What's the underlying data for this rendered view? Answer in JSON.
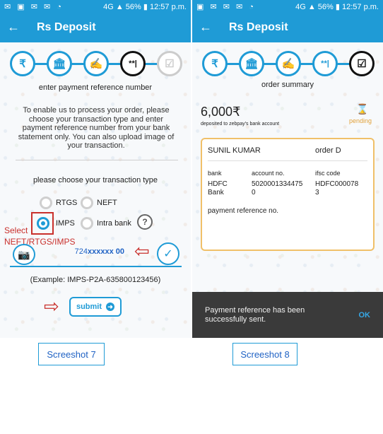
{
  "status_bar": {
    "battery": "56%",
    "time": "12:57 p.m.",
    "signal": "4G"
  },
  "appbar": {
    "title": "Rs Deposit",
    "back_icon": "arrow-left-icon"
  },
  "colors": {
    "primary": "#1f9bd6",
    "annotation_red": "#c9302c",
    "pending": "#e2a23b",
    "card_border": "#f0c069"
  },
  "screen1": {
    "steps": [
      {
        "glyph": "₹",
        "icon": "rupee-icon"
      },
      {
        "glyph": "🏛",
        "icon": "bank-icon"
      },
      {
        "glyph": "✍",
        "icon": "sign-icon"
      },
      {
        "glyph": "**|",
        "icon": "password-icon"
      },
      {
        "glyph": "☑",
        "icon": "checkbox-icon"
      }
    ],
    "heading": "enter payment reference number",
    "instructions": "To enable us to process your order, please choose your transaction type and enter payment reference number from your bank statement only. You can also upload image of your transaction.",
    "choose_label": "please choose your transaction type",
    "options": {
      "rtgs": "RTGS",
      "neft": "NEFT",
      "imps": "IMPS",
      "intra_bank": "Intra bank"
    },
    "selected": "IMPS",
    "help_glyph": "?",
    "annotation_text": "Select NEFT/RTGS/IMPS",
    "reference_value_prefix": "724",
    "reference_value_masked": "xxxxxx 00",
    "example": "(Example: IMPS-P2A-635800123456)",
    "submit_label": "submit"
  },
  "screen2": {
    "steps": [
      {
        "glyph": "₹",
        "icon": "rupee-icon"
      },
      {
        "glyph": "🏛",
        "icon": "bank-icon"
      },
      {
        "glyph": "✍",
        "icon": "sign-icon"
      },
      {
        "glyph": "**|",
        "icon": "password-icon"
      },
      {
        "glyph": "☑",
        "icon": "checkbox-icon"
      }
    ],
    "heading": "order summary",
    "amount": "6,000₹",
    "amount_caption": "deposited to zebpay's bank account",
    "status": "pending",
    "order": {
      "name": "SUNIL KUMAR",
      "order_label": "order D",
      "col_bank": "bank",
      "col_account": "account no.",
      "col_ifsc": "ifsc code",
      "bank_line1": "HDFC",
      "bank_line2": "Bank",
      "account_line1": "5020001334475",
      "account_line2": "0",
      "ifsc_line1": "HDFC000078",
      "ifsc_line2": "3",
      "payment_ref_label": "payment reference no."
    },
    "snackbar": {
      "message": "Payment reference has been successfully sent.",
      "action": "OK"
    }
  },
  "captions": {
    "left": "Screeshot 7",
    "right": "Screeshot 8"
  }
}
